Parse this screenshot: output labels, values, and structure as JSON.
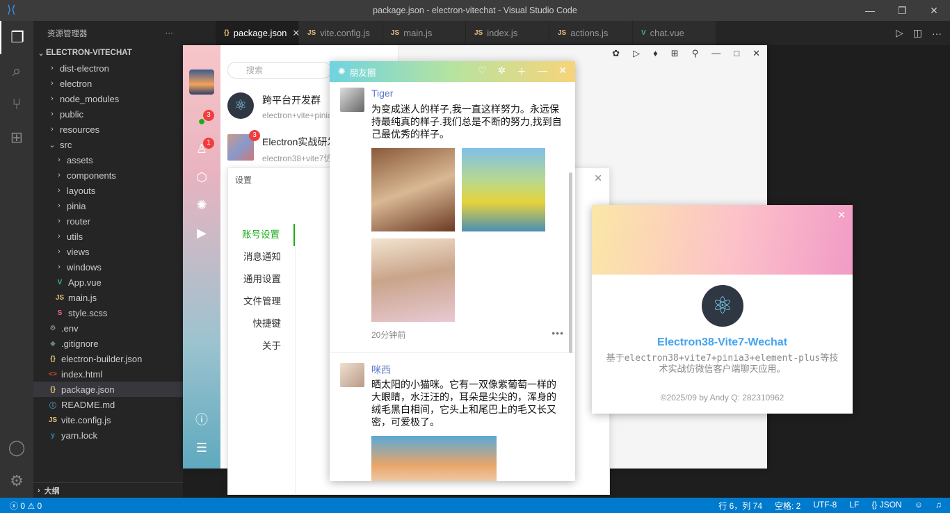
{
  "window": {
    "title": "package.json - electron-vitechat - Visual Studio Code"
  },
  "colors": {
    "accent": "#007acc",
    "titlebar": "#3c3c3c",
    "sidebar": "#252526",
    "editor": "#1e1e1e",
    "chat_green": "#1aad19",
    "link_blue": "#5a78c8"
  },
  "explorer": {
    "header": "资源管理器",
    "more": "···",
    "root": "ELECTRON-VITECHAT",
    "items": [
      {
        "label": "dist-electron",
        "icon": "chevron-right"
      },
      {
        "label": "electron",
        "icon": "chevron-right"
      },
      {
        "label": "node_modules",
        "icon": "chevron-right"
      },
      {
        "label": "public",
        "icon": "chevron-right"
      },
      {
        "label": "resources",
        "icon": "chevron-right"
      },
      {
        "label": "src",
        "icon": "chevron-down"
      },
      {
        "label": "assets",
        "icon": "chevron-right"
      },
      {
        "label": "components",
        "icon": "chevron-right"
      },
      {
        "label": "layouts",
        "icon": "chevron-right"
      },
      {
        "label": "pinia",
        "icon": "chevron-right"
      },
      {
        "label": "router",
        "icon": "chevron-right"
      },
      {
        "label": "utils",
        "icon": "chevron-right"
      },
      {
        "label": "views",
        "icon": "chevron-right"
      },
      {
        "label": "windows",
        "icon": "chevron-right"
      },
      {
        "label": "App.vue",
        "icon": "vue-icon"
      },
      {
        "label": "main.js",
        "icon": "js-icon"
      },
      {
        "label": "style.scss",
        "icon": "scss-icon"
      },
      {
        "label": ".env",
        "icon": "gear-icon"
      },
      {
        "label": ".gitignore",
        "icon": "git-icon"
      },
      {
        "label": "electron-builder.json",
        "icon": "json-icon"
      },
      {
        "label": "index.html",
        "icon": "html-icon"
      },
      {
        "label": "package.json",
        "icon": "json-icon"
      },
      {
        "label": "README.md",
        "icon": "info-icon"
      },
      {
        "label": "vite.config.js",
        "icon": "js-icon"
      },
      {
        "label": "yarn.lock",
        "icon": "yarn-icon"
      }
    ],
    "outline": "大纲"
  },
  "tabs": [
    {
      "label": "package.json",
      "icon": "{}",
      "close": "✕"
    },
    {
      "label": "vite.config.js",
      "icon": "JS"
    },
    {
      "label": "main.js",
      "icon": "JS"
    },
    {
      "label": "index.js",
      "icon": "JS"
    },
    {
      "label": "actions.js",
      "icon": "JS"
    },
    {
      "label": "chat.vue",
      "icon": "V"
    }
  ],
  "statusbar": {
    "errors": "0",
    "warnings": "0",
    "position": "行 6，列 74",
    "spaces": "空格: 2",
    "encoding": "UTF-8",
    "eol": "LF",
    "language": "JSON"
  },
  "chat": {
    "search_placeholder": "搜索",
    "nav_badges": {
      "messages": "3",
      "contacts": "1"
    },
    "conversations": [
      {
        "name": "跨平台开发群",
        "preview": "electron+vite+pinia"
      },
      {
        "name": "Electron实战研发",
        "preview": "electron38+vite7仿",
        "badge": "3"
      }
    ]
  },
  "settings": {
    "title": "设置",
    "close": "✕",
    "nav": [
      "账号设置",
      "消息通知",
      "通用设置",
      "文件管理",
      "快捷键",
      "关于"
    ]
  },
  "moments": {
    "title": "朋友圈",
    "posts": [
      {
        "author": "Tiger",
        "text": "为变成迷人的样子,我一直这样努力。永远保持最纯真的样子.我们总是不断的努力,找到自己最优秀的样子。",
        "time": "20分钟前",
        "more": "•••"
      },
      {
        "author": "咪西",
        "text": "晒太阳的小猫咪。它有一双像紫葡萄一样的大眼睛，水汪汪的，耳朵是尖尖的，浑身的绒毛黑白相间，它头上和尾巴上的毛又长又密，可爱极了。"
      }
    ]
  },
  "about": {
    "close": "✕",
    "name": "Electron38-Vite7-Wechat",
    "desc": "基于electron38+vite7+pinia3+element-plus等技术实战仿微信客户端聊天应用。",
    "copyright": "©2025/09 by Andy   Q: 282310962"
  }
}
